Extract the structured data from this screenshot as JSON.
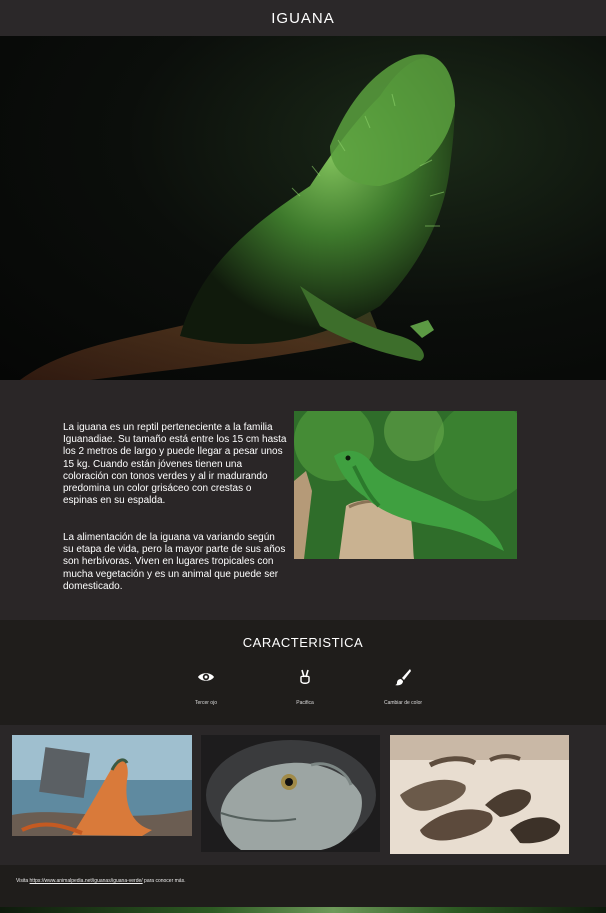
{
  "header": {
    "title": "IGUANA"
  },
  "intro": {
    "paragraph1": "La iguana es un reptil perteneciente a la familia Iguanadiae. Su tamaño está entre los 15 cm hasta los 2 metros de largo y puede llegar a pesar unos 15 kg. Cuando están jóvenes tienen una coloración con tonos verdes y al ir madurando predomina un color grisáceo con crestas o espinas en su espalda.",
    "paragraph2": "La alimentación de la iguana va variando según su etapa de vida, pero la mayor parte de sus años son herbívoras. Viven en lugares tropicales con mucha vegetación y es un animal que puede ser domesticado."
  },
  "features": {
    "title": "CARACTERISTICA",
    "items": [
      {
        "label": "Tercer ojo",
        "icon": "eye-icon"
      },
      {
        "label": "Pacifica",
        "icon": "peace-hand-icon"
      },
      {
        "label": "Cambiar de color",
        "icon": "paintbrush-icon"
      }
    ]
  },
  "footer": {
    "prefix": "Visita ",
    "link": "https://www.animalpedia.net/iguanas/iguana-verde/",
    "suffix": " para conocer más."
  }
}
